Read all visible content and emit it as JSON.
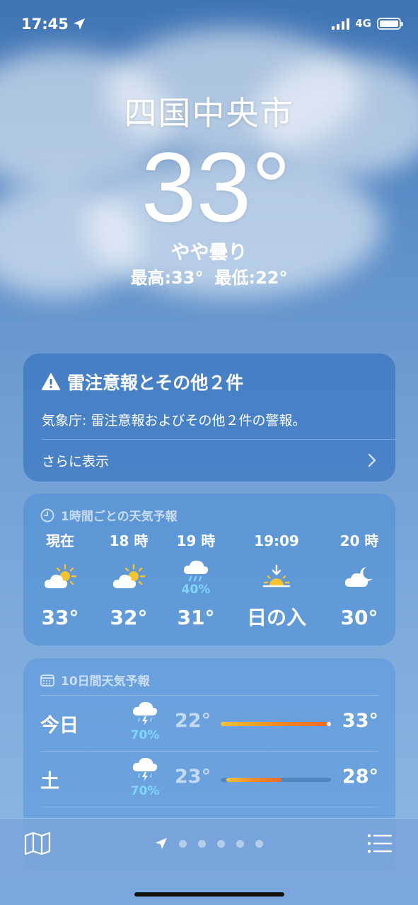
{
  "status_bar": {
    "time": "17:45",
    "network": "4G",
    "location_icon": "location-arrow-icon",
    "battery_level": 1.0
  },
  "hero": {
    "city": "四国中央市",
    "temperature": "33°",
    "condition": "やや曇り",
    "high": "最高:33°",
    "low": "最低:22°"
  },
  "alert": {
    "icon": "warning-icon",
    "title": "雷注意報とその他２件",
    "body": "気象庁: 雷注意報およびその他２件の警報。",
    "more_label": "さらに表示"
  },
  "hourly": {
    "icon": "clock-icon",
    "title": "1時間ごとの天気予報",
    "items": [
      {
        "label": "現在",
        "icon": "partly-cloudy-sun-icon",
        "pop": "",
        "value": "33°"
      },
      {
        "label": "18 時",
        "icon": "partly-cloudy-sun-icon",
        "pop": "",
        "value": "32°"
      },
      {
        "label": "19 時",
        "icon": "rain-cloud-icon",
        "pop": "40%",
        "value": "31°"
      },
      {
        "label": "19:09",
        "icon": "sunset-icon",
        "pop": "",
        "value": "日の入"
      },
      {
        "label": "20 時",
        "icon": "partly-cloudy-moon-icon",
        "pop": "",
        "value": "30°"
      }
    ]
  },
  "daily": {
    "icon": "calendar-icon",
    "title": "10日間天気予報",
    "days": [
      {
        "name": "今日",
        "icon": "thunderstorm-icon",
        "pop": "70%",
        "low": "22°",
        "high": "33°",
        "range_start": 0.0,
        "range_end": 1.0,
        "current": 1.0
      },
      {
        "name": "土",
        "icon": "thunderstorm-icon",
        "pop": "70%",
        "low": "23°",
        "high": "28°",
        "range_start": 0.05,
        "range_end": 0.55,
        "current": null
      }
    ]
  },
  "bottom_bar": {
    "map_icon": "map-icon",
    "list_icon": "list-icon",
    "page_count": 5,
    "current_location_icon": "location-arrow-icon"
  },
  "colors": {
    "background_top": "#3f74b4",
    "background_bottom": "#8db8e3",
    "precip": "#7fd6ff",
    "sun": "#f5c330",
    "temp_bar": "#ef6a2c"
  }
}
